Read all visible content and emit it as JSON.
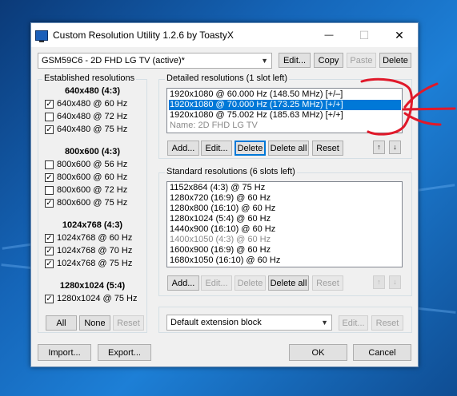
{
  "window": {
    "title": "Custom Resolution Utility 1.2.6 by ToastyX",
    "minimize": "—",
    "maximize": "☐",
    "close": "✕"
  },
  "monitor": {
    "selected": "GSM59C6 - 2D FHD LG TV (active)*"
  },
  "top_buttons": {
    "edit": "Edit...",
    "copy": "Copy",
    "paste": "Paste",
    "delete": "Delete"
  },
  "established": {
    "label": "Established resolutions",
    "groups": [
      {
        "header": "640x480 (4:3)",
        "items": [
          {
            "text": "640x480 @ 60 Hz",
            "checked": true
          },
          {
            "text": "640x480 @ 72 Hz",
            "checked": false
          },
          {
            "text": "640x480 @ 75 Hz",
            "checked": true
          }
        ]
      },
      {
        "header": "800x600 (4:3)",
        "items": [
          {
            "text": "800x600 @ 56 Hz",
            "checked": false
          },
          {
            "text": "800x600 @ 60 Hz",
            "checked": true
          },
          {
            "text": "800x600 @ 72 Hz",
            "checked": false
          },
          {
            "text": "800x600 @ 75 Hz",
            "checked": true
          }
        ]
      },
      {
        "header": "1024x768 (4:3)",
        "items": [
          {
            "text": "1024x768 @ 60 Hz",
            "checked": true
          },
          {
            "text": "1024x768 @ 70 Hz",
            "checked": true
          },
          {
            "text": "1024x768 @ 75 Hz",
            "checked": true
          }
        ]
      },
      {
        "header": "1280x1024 (5:4)",
        "items": [
          {
            "text": "1280x1024 @ 75 Hz",
            "checked": true
          }
        ]
      }
    ],
    "buttons": {
      "all": "All",
      "none": "None",
      "reset": "Reset"
    }
  },
  "detailed": {
    "label": "Detailed resolutions (1 slot left)",
    "items": [
      {
        "text": "1920x1080 @ 60.000 Hz (148.50 MHz) [+/–]",
        "selected": false
      },
      {
        "text": "1920x1080 @ 70.000 Hz (173.25 MHz) [+/+]",
        "selected": true
      },
      {
        "text": "1920x1080 @ 75.002 Hz (185.63 MHz) [+/+]",
        "selected": false
      },
      {
        "text": "Name: 2D FHD LG TV",
        "selected": false,
        "gray": true
      }
    ],
    "buttons": {
      "add": "Add...",
      "edit": "Edit...",
      "delete": "Delete",
      "delete_all": "Delete all",
      "reset": "Reset",
      "up": "↑",
      "down": "↓"
    }
  },
  "standard": {
    "label": "Standard resolutions (6 slots left)",
    "items": [
      {
        "text": "1152x864 (4:3) @ 75 Hz",
        "gray": false
      },
      {
        "text": "1280x720 (16:9) @ 60 Hz",
        "gray": false
      },
      {
        "text": "1280x800 (16:10) @ 60 Hz",
        "gray": false
      },
      {
        "text": "1280x1024 (5:4) @ 60 Hz",
        "gray": false
      },
      {
        "text": "1440x900 (16:10) @ 60 Hz",
        "gray": false
      },
      {
        "text": "1400x1050 (4:3) @ 60 Hz",
        "gray": true
      },
      {
        "text": "1600x900 (16:9) @ 60 Hz",
        "gray": false
      },
      {
        "text": "1680x1050 (16:10) @ 60 Hz",
        "gray": false
      }
    ],
    "buttons": {
      "add": "Add...",
      "edit": "Edit...",
      "delete": "Delete",
      "delete_all": "Delete all",
      "reset": "Reset",
      "up": "↑",
      "down": "↓"
    }
  },
  "extension": {
    "selected": "Default extension block",
    "edit": "Edit...",
    "reset": "Reset"
  },
  "bottom": {
    "import": "Import...",
    "export": "Export...",
    "ok": "OK",
    "cancel": "Cancel"
  },
  "annotation": {
    "color": "#e0192a"
  },
  "colors": {
    "selection": "#0078d7",
    "desktop": "#1565b8"
  }
}
